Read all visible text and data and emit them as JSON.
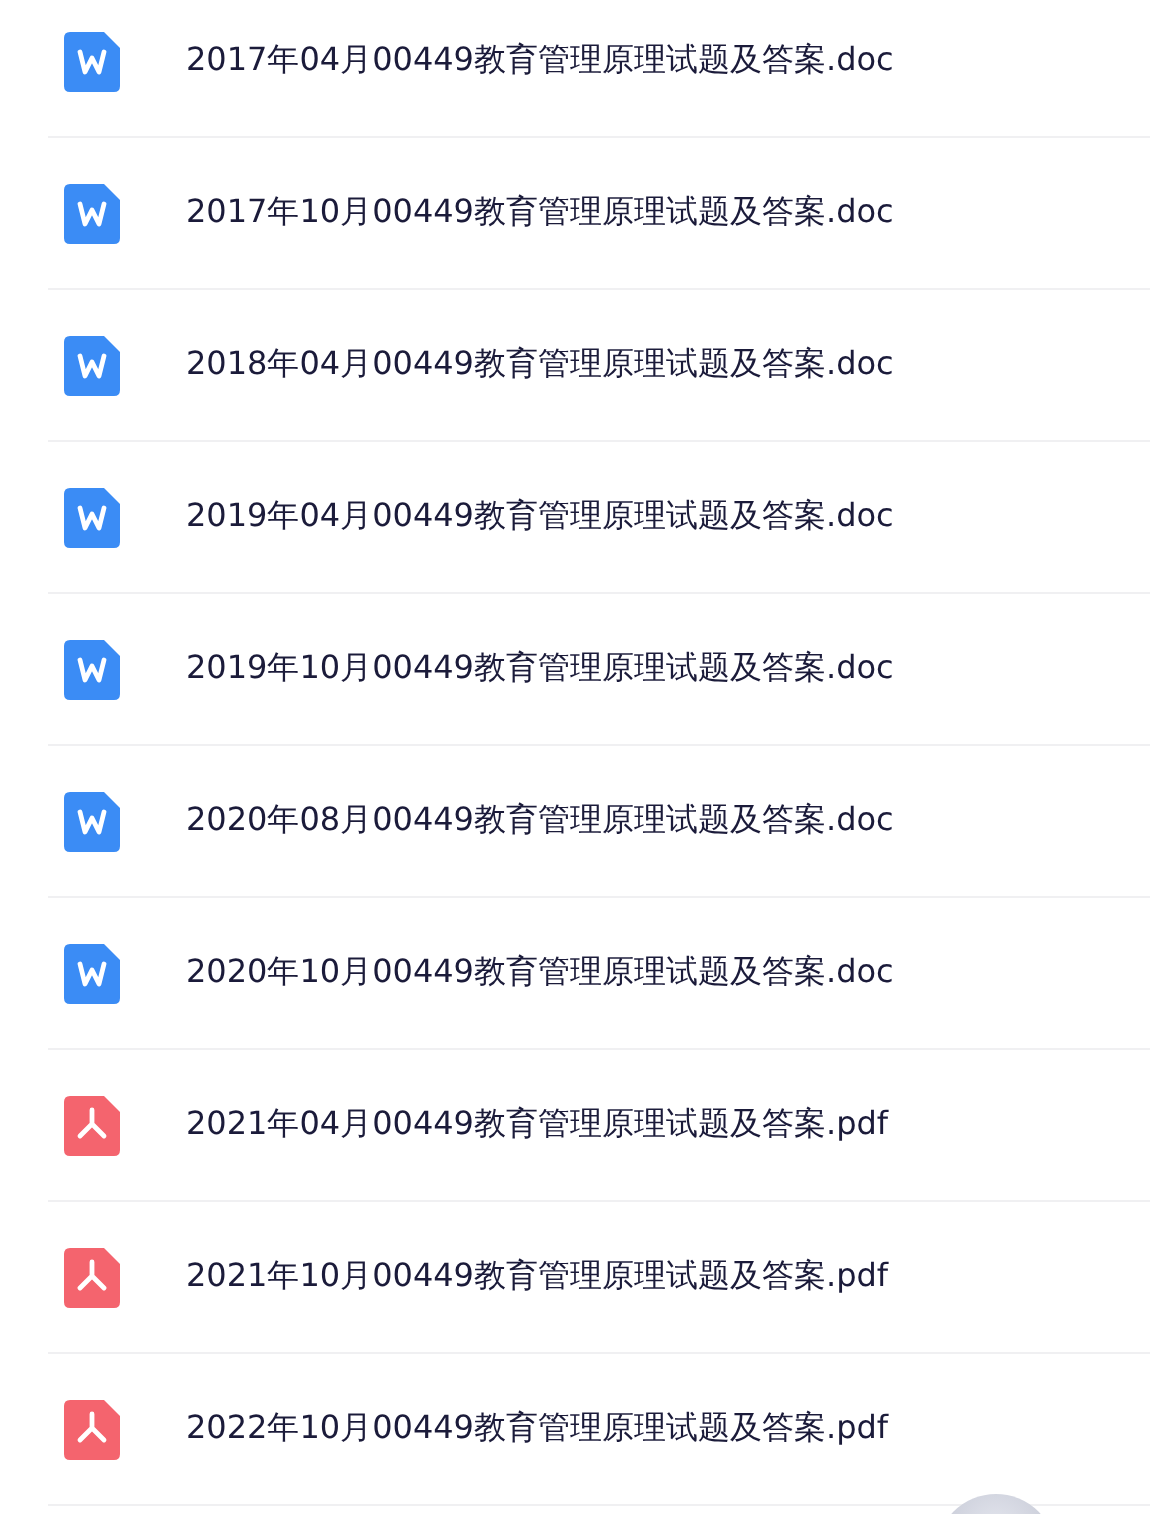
{
  "files": [
    {
      "kind": "doc",
      "name": "2017年04月00449教育管理原理试题及答案.doc"
    },
    {
      "kind": "doc",
      "name": "2017年10月00449教育管理原理试题及答案.doc"
    },
    {
      "kind": "doc",
      "name": "2018年04月00449教育管理原理试题及答案.doc"
    },
    {
      "kind": "doc",
      "name": "2019年04月00449教育管理原理试题及答案.doc"
    },
    {
      "kind": "doc",
      "name": "2019年10月00449教育管理原理试题及答案.doc"
    },
    {
      "kind": "doc",
      "name": "2020年08月00449教育管理原理试题及答案.doc"
    },
    {
      "kind": "doc",
      "name": "2020年10月00449教育管理原理试题及答案.doc"
    },
    {
      "kind": "pdf",
      "name": "2021年04月00449教育管理原理试题及答案.pdf"
    },
    {
      "kind": "pdf",
      "name": "2021年10月00449教育管理原理试题及答案.pdf"
    },
    {
      "kind": "pdf",
      "name": "2022年10月00449教育管理原理试题及答案.pdf"
    }
  ]
}
